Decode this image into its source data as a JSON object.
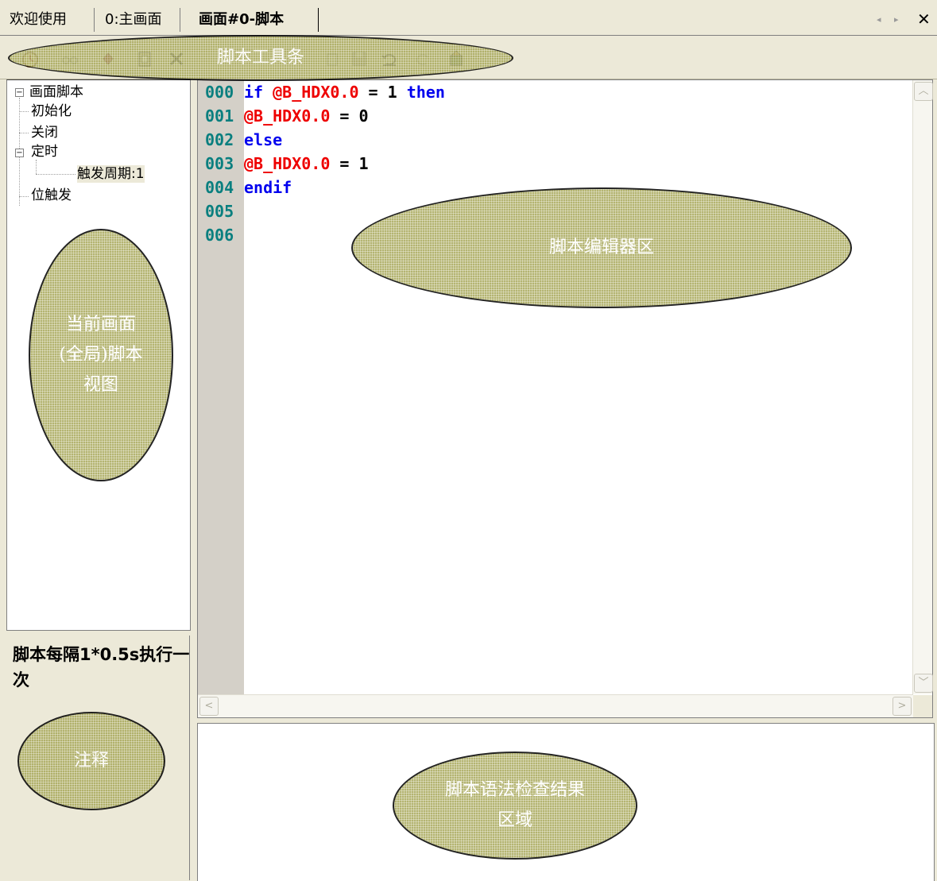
{
  "tabs": [
    {
      "label": "欢迎使用"
    },
    {
      "label": "0:主画面"
    },
    {
      "label": "画面#0-脚本",
      "active": true
    }
  ],
  "tab_nav": {
    "prev": "◂",
    "next": "▸",
    "close": "✕"
  },
  "toolbar": {
    "icons": [
      "clock-icon",
      "glasses-icon",
      "diamond-icon",
      "paste-icon",
      "delete-icon",
      "copy-icon",
      "save-icon",
      "undo-icon",
      "redo-icon",
      "compile-icon"
    ]
  },
  "tree": {
    "root": "画面脚本",
    "items": [
      "初始化",
      "关闭",
      "定时",
      "触发周期:1",
      "位触发"
    ],
    "expand_marker": "−"
  },
  "note": {
    "text": "脚本每隔1*0.5s执行一次"
  },
  "editor": {
    "lines": [
      {
        "num": "000",
        "parts": [
          {
            "t": "if ",
            "c": "kw"
          },
          {
            "t": "@B_HDX0.0",
            "c": "var"
          },
          {
            "t": " = 1 ",
            "c": "op"
          },
          {
            "t": "then",
            "c": "kw"
          }
        ]
      },
      {
        "num": "001",
        "parts": [
          {
            "t": "@B_HDX0.0",
            "c": "var"
          },
          {
            "t": " = 0",
            "c": "op"
          }
        ]
      },
      {
        "num": "002",
        "parts": [
          {
            "t": "else",
            "c": "kw"
          }
        ]
      },
      {
        "num": "003",
        "parts": [
          {
            "t": "@B_HDX0.0",
            "c": "var"
          },
          {
            "t": " = 1",
            "c": "op"
          }
        ]
      },
      {
        "num": "004",
        "parts": [
          {
            "t": "endif",
            "c": "kw"
          }
        ]
      },
      {
        "num": "005",
        "parts": []
      },
      {
        "num": "006",
        "parts": []
      }
    ]
  },
  "callouts": {
    "toolbar": "脚本工具条",
    "editor": "脚本编辑器区",
    "tree": "当前画面(全局)脚本视图",
    "note": "注释",
    "results": "脚本语法检查结果区域"
  },
  "colors": {
    "keyword": "#0000ee",
    "variable": "#ee0000",
    "line_number": "#0a7f7f",
    "callout_fill": "#a8a85a"
  }
}
